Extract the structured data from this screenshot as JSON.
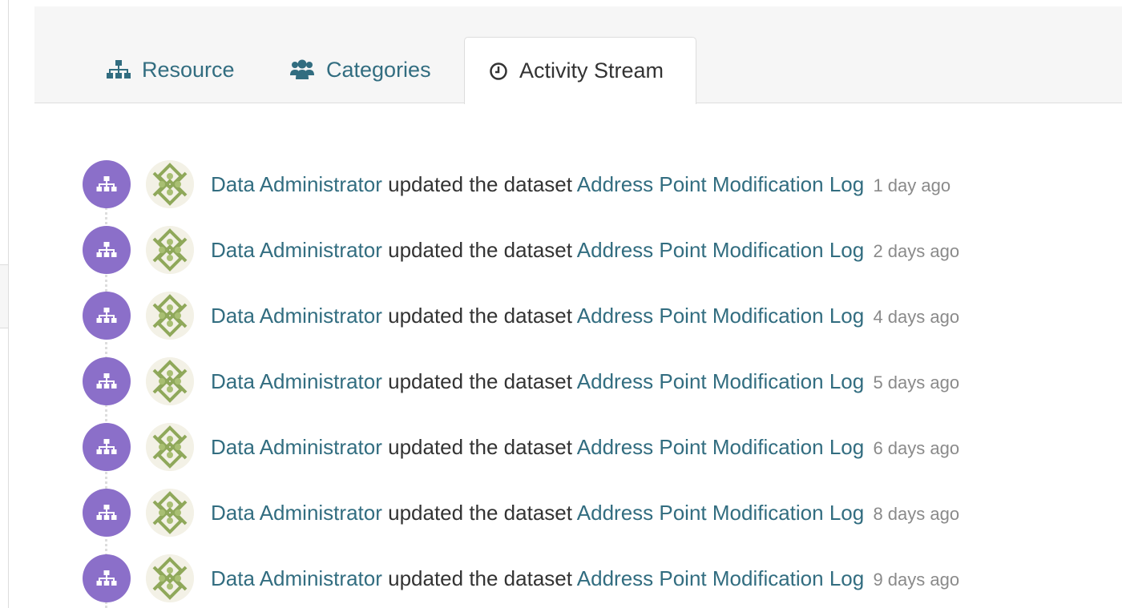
{
  "tabs": [
    {
      "label": "Resource",
      "icon": "sitemap-icon",
      "active": false
    },
    {
      "label": "Categories",
      "icon": "users-icon",
      "active": false
    },
    {
      "label": "Activity Stream",
      "icon": "clock-icon",
      "active": true
    }
  ],
  "activity": {
    "items": [
      {
        "actor": "Data Administrator",
        "action": "updated the dataset",
        "object": "Address Point Modification Log",
        "date": "1 day ago"
      },
      {
        "actor": "Data Administrator",
        "action": "updated the dataset",
        "object": "Address Point Modification Log",
        "date": "2 days ago"
      },
      {
        "actor": "Data Administrator",
        "action": "updated the dataset",
        "object": "Address Point Modification Log",
        "date": "4 days ago"
      },
      {
        "actor": "Data Administrator",
        "action": "updated the dataset",
        "object": "Address Point Modification Log",
        "date": "5 days ago"
      },
      {
        "actor": "Data Administrator",
        "action": "updated the dataset",
        "object": "Address Point Modification Log",
        "date": "6 days ago"
      },
      {
        "actor": "Data Administrator",
        "action": "updated the dataset",
        "object": "Address Point Modification Log",
        "date": "8 days ago"
      },
      {
        "actor": "Data Administrator",
        "action": "updated the dataset",
        "object": "Address Point Modification Log",
        "date": "9 days ago"
      }
    ]
  },
  "colors": {
    "link": "#326d80",
    "badge": "#8b6fc9",
    "tab_bar": "#f6f6f6",
    "date": "#8a8a8a"
  }
}
